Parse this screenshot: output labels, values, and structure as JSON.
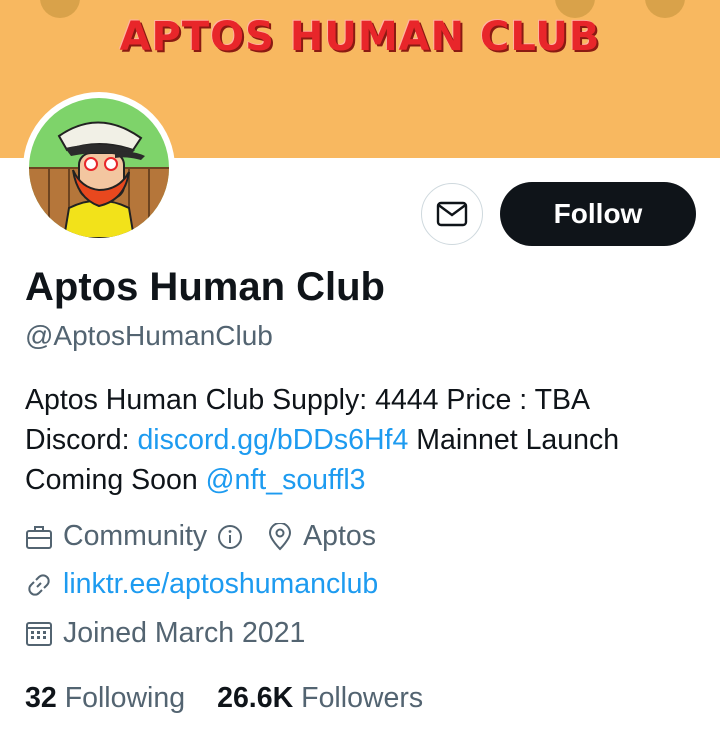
{
  "banner": {
    "title": "APTOS HUMAN CLUB",
    "background": "#f8b860",
    "title_color": "#e8262a"
  },
  "profile": {
    "name": "Aptos Human Club",
    "handle": "@AptosHumanClub",
    "bio": {
      "line1": "Aptos Human Club Supply: 4444 Price : TBA",
      "discord_prefix": "Discord: ",
      "discord_link": "discord.gg/bDDs6Hf4",
      "discord_suffix": " Mainnet Launch",
      "coming_soon": "Coming Soon ",
      "mention": "@nft_souffl3"
    },
    "category": "Community",
    "location": "Aptos",
    "website": "linktr.ee/aptoshumanclub",
    "joined": "Joined March 2021"
  },
  "actions": {
    "message_icon": "envelope-icon",
    "follow_label": "Follow"
  },
  "stats": {
    "following_count": "32",
    "following_label": "Following",
    "followers_count": "26.6K",
    "followers_label": "Followers"
  },
  "colors": {
    "link": "#1d9bf0",
    "secondary_text": "#536471",
    "primary_text": "#0f1419"
  }
}
